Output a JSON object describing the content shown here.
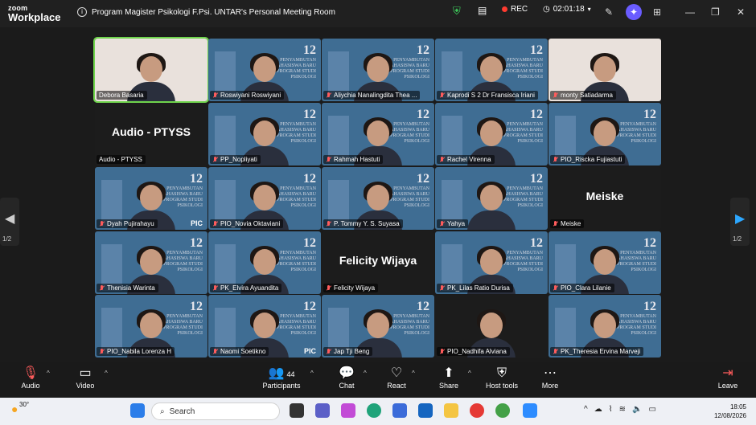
{
  "app": {
    "logo_line1": "zoom",
    "logo_line2": "Workplace",
    "meeting_title": "Program Magister Psikologi F.Psi. UNTAR's Personal Meeting Room",
    "rec_label": "REC",
    "timer": "02:01:18"
  },
  "banner": {
    "big": "12",
    "small_lines": [
      "PENYAMBUTAN",
      "MAHASISWA BARU",
      "PROGRAM STUDI",
      "PSIKOLOGI"
    ],
    "pic_label": "PIC"
  },
  "tiles": [
    {
      "name": "Debora Basaria",
      "style": "light",
      "active": true
    },
    {
      "name": "Roswiyani Roswiyani",
      "style": "banner"
    },
    {
      "name": "Aliychia Nanalingdita Thea ...",
      "style": "banner"
    },
    {
      "name": "Kaprodi S 2 Dr Fransisca Iriani",
      "style": "banner"
    },
    {
      "name": "monty Satiadarma",
      "style": "light"
    },
    {
      "name": "Audio - PTYSS",
      "style": "dark",
      "center": "Audio - PTYSS"
    },
    {
      "name": "PP_Nopliyati",
      "style": "banner"
    },
    {
      "name": "Rahmah Hastuti",
      "style": "banner"
    },
    {
      "name": "Rachel Virenna",
      "style": "banner"
    },
    {
      "name": "PIO_Riscka Fujiastuti",
      "style": "banner"
    },
    {
      "name": "Dyah Pujirahayu",
      "style": "banner",
      "pic": true
    },
    {
      "name": "PIO_Novia Oktaviani",
      "style": "banner"
    },
    {
      "name": "P. Tommy Y. S. Suyasa",
      "style": "banner"
    },
    {
      "name": "Yahya",
      "style": "banner"
    },
    {
      "name": "Meiske",
      "style": "dark",
      "center": "Meiske"
    },
    {
      "name": "Thenisia Warinta",
      "style": "banner"
    },
    {
      "name": "PK_Elvira Ayuandita",
      "style": "banner"
    },
    {
      "name": "Felicity Wijaya",
      "style": "dark",
      "center": "Felicity Wijaya"
    },
    {
      "name": "PK_Lilas Ratio Durisa",
      "style": "banner"
    },
    {
      "name": "PIO_Clara Lilanie",
      "style": "banner"
    },
    {
      "name": "PIO_Nabila Lorenza H",
      "style": "banner"
    },
    {
      "name": "Naomi Soetikno",
      "style": "banner",
      "pic": true
    },
    {
      "name": "Jap Tji Beng",
      "style": "banner"
    },
    {
      "name": "PIO_Nadhifa Alviana",
      "style": "dark"
    },
    {
      "name": "PK_Theresia Ervina Marveji",
      "style": "banner"
    }
  ],
  "nav": {
    "page": "1/2"
  },
  "toolbar": {
    "audio": "Audio",
    "video": "Video",
    "participants": "Participants",
    "participant_count": "44",
    "chat": "Chat",
    "react": "React",
    "share": "Share",
    "host_tools": "Host tools",
    "more": "More",
    "leave": "Leave"
  },
  "taskbar": {
    "weather": "30°",
    "search_placeholder": "Search",
    "time": "18:05",
    "date": "12/08/2026"
  }
}
